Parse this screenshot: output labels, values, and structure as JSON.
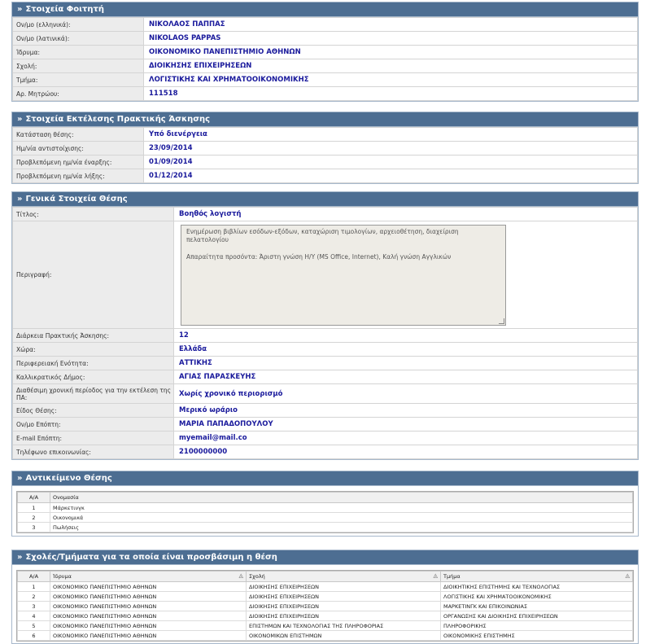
{
  "student": {
    "title": "Στοιχεία Φοιτητή",
    "rows": [
      {
        "label": "Ον/μο (ελληνικά):",
        "value": "ΝΙΚΟΛΑΟΣ ΠΑΠΠΑΣ"
      },
      {
        "label": "Ον/μο (λατινικά):",
        "value": "NIKOLAOS PAPPAS"
      },
      {
        "label": "Ίδρυμα:",
        "value": "ΟΙΚΟΝΟΜΙΚΟ ΠΑΝΕΠΙΣΤΗΜΙΟ ΑΘΗΝΩΝ"
      },
      {
        "label": "Σχολή:",
        "value": "ΔΙΟΙΚΗΣΗΣ ΕΠΙΧΕΙΡΗΣΕΩΝ"
      },
      {
        "label": "Τμήμα:",
        "value": "ΛΟΓΙΣΤΙΚΗΣ ΚΑΙ ΧΡΗΜΑΤΟΟΙΚΟΝΟΜΙΚΗΣ"
      },
      {
        "label": "Αρ. Μητρώου:",
        "value": "111518"
      }
    ]
  },
  "execution": {
    "title": "Στοιχεία Εκτέλεσης Πρακτικής Άσκησης",
    "rows": [
      {
        "label": "Κατάσταση θέσης:",
        "value": "Υπό διενέργεια"
      },
      {
        "label": "Ημ/νία αντιστοίχισης:",
        "value": "23/09/2014"
      },
      {
        "label": "Προβλεπόμενη ημ/νία έναρξης:",
        "value": "01/09/2014"
      },
      {
        "label": "Προβλεπόμενη ημ/νία λήξης:",
        "value": "01/12/2014"
      }
    ]
  },
  "position": {
    "title": "Γενικά Στοιχεία Θέσης",
    "title_label": "Τίτλος:",
    "title_value": "Βοηθός λογιστή",
    "desc_label": "Περιγραφή:",
    "desc_line1": "Ενημέρωση βιβλίων εσόδων-εξόδων, καταχώριση τιμολογίων, αρχειοθέτηση, διαχείριση πελατολογίου",
    "desc_line2": "Απαραίτητα προσόντα: Άριστη γνώση Η/Υ (MS Office, Internet), Καλή γνώση Αγγλικών",
    "rows": [
      {
        "label": "Διάρκεια Πρακτικής Άσκησης:",
        "value": "12"
      },
      {
        "label": "Χώρα:",
        "value": "Ελλάδα"
      },
      {
        "label": "Περιφερειακή Ενότητα:",
        "value": "ΑΤΤΙΚΗΣ"
      },
      {
        "label": "Καλλικρατικός Δήμος:",
        "value": "ΑΓΙΑΣ ΠΑΡΑΣΚΕΥΗΣ"
      },
      {
        "label": "Διαθέσιμη χρονική περίοδος για την εκτέλεση της ΠΑ:",
        "value": "Χωρίς χρονικό περιορισμό"
      },
      {
        "label": "Είδος Θέσης:",
        "value": "Μερικό ωράριο"
      },
      {
        "label": "Ον/μο Επόπτη:",
        "value": "ΜΑΡΙΑ ΠΑΠΑΔΟΠΟΥΛΟΥ"
      },
      {
        "label": "E-mail Επόπτη:",
        "value": "myemail@mail.co"
      },
      {
        "label": "Τηλέφωνο επικοινωνίας:",
        "value": "2100000000"
      }
    ]
  },
  "subject": {
    "title": "Αντικείμενο Θέσης",
    "columns": [
      "Α/Α",
      "Ονομασία"
    ],
    "rows": [
      [
        "1",
        "Μάρκετινγκ"
      ],
      [
        "2",
        "Οικονομικά"
      ],
      [
        "3",
        "Πωλήσεις"
      ]
    ]
  },
  "schools": {
    "title": "Σχολές/Τμήματα για τα οποία είναι προσβάσιμη η θέση",
    "columns": [
      "Α/Α",
      "Ίδρυμα",
      "Σχολή",
      "Τμήμα"
    ],
    "sort_glyph": "◬",
    "rows": [
      [
        "1",
        "ΟΙΚΟΝΟΜΙΚΟ ΠΑΝΕΠΙΣΤΗΜΙΟ ΑΘΗΝΩΝ",
        "ΔΙΟΙΚΗΣΗΣ ΕΠΙΧΕΙΡΗΣΕΩΝ",
        "ΔΙΟΙΚΗΤΙΚΗΣ ΕΠΙΣΤΗΜΗΣ ΚΑΙ ΤΕΧΝΟΛΟΓΙΑΣ"
      ],
      [
        "2",
        "ΟΙΚΟΝΟΜΙΚΟ ΠΑΝΕΠΙΣΤΗΜΙΟ ΑΘΗΝΩΝ",
        "ΔΙΟΙΚΗΣΗΣ ΕΠΙΧΕΙΡΗΣΕΩΝ",
        "ΛΟΓΙΣΤΙΚΗΣ ΚΑΙ ΧΡΗΜΑΤΟΟΙΚΟΝΟΜΙΚΗΣ"
      ],
      [
        "3",
        "ΟΙΚΟΝΟΜΙΚΟ ΠΑΝΕΠΙΣΤΗΜΙΟ ΑΘΗΝΩΝ",
        "ΔΙΟΙΚΗΣΗΣ ΕΠΙΧΕΙΡΗΣΕΩΝ",
        "ΜΑΡΚΕΤΙΝΓΚ ΚΑΙ ΕΠΙΚΟΙΝΩΝΙΑΣ"
      ],
      [
        "4",
        "ΟΙΚΟΝΟΜΙΚΟ ΠΑΝΕΠΙΣΤΗΜΙΟ ΑΘΗΝΩΝ",
        "ΔΙΟΙΚΗΣΗΣ ΕΠΙΧΕΙΡΗΣΕΩΝ",
        "ΟΡΓΑΝΩΣΗΣ ΚΑΙ ΔΙΟΙΚΗΣΗΣ ΕΠΙΧΕΙΡΗΣΕΩΝ"
      ],
      [
        "5",
        "ΟΙΚΟΝΟΜΙΚΟ ΠΑΝΕΠΙΣΤΗΜΙΟ ΑΘΗΝΩΝ",
        "ΕΠΙΣΤΗΜΩΝ ΚΑΙ ΤΕΧΝΟΛΟΓΙΑΣ ΤΗΣ ΠΛΗΡΟΦΟΡΙΑΣ",
        "ΠΛΗΡΟΦΟΡΙΚΗΣ"
      ],
      [
        "6",
        "ΟΙΚΟΝΟΜΙΚΟ ΠΑΝΕΠΙΣΤΗΜΙΟ ΑΘΗΝΩΝ",
        "ΟΙΚΟΝΟΜΙΚΩΝ ΕΠΙΣΤΗΜΩΝ",
        "ΟΙΚΟΝΟΜΙΚΗΣ ΕΠΙΣΤΗΜΗΣ"
      ]
    ]
  },
  "header_glyph": "»",
  "colors": {
    "header_bg": "#4d6e92",
    "value_text": "#1a1a9c",
    "label_bg": "#ececec"
  }
}
